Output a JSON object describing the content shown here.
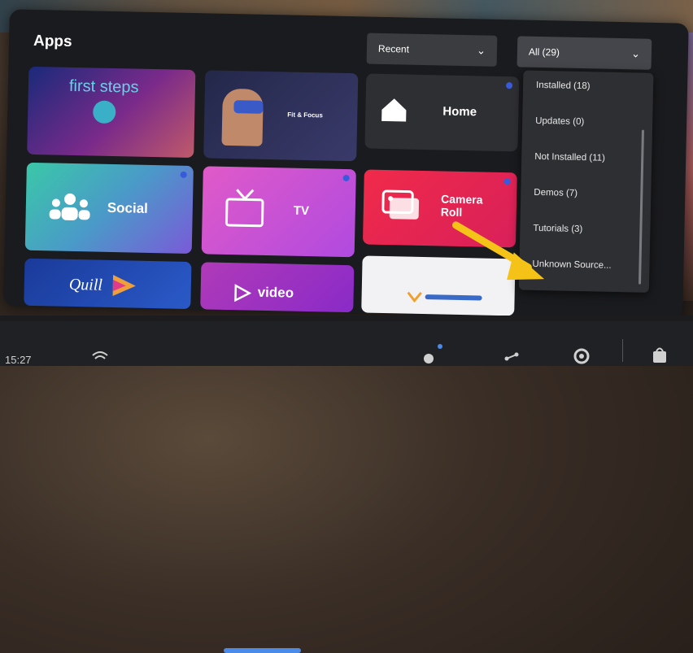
{
  "header": {
    "title": "Apps"
  },
  "filters": {
    "sort": {
      "label": "Recent"
    },
    "category": {
      "label": "All (29)",
      "options": [
        "Installed (18)",
        "Updates (0)",
        "Not Installed (11)",
        "Demos (7)",
        "Tutorials (3)",
        "Unknown Source..."
      ]
    }
  },
  "tiles": [
    {
      "label": "first steps"
    },
    {
      "label": "Fit & Focus"
    },
    {
      "label": "Home"
    },
    {
      "label": "Social"
    },
    {
      "label": "TV"
    },
    {
      "label": "Camera Roll"
    },
    {
      "label": "Quill"
    },
    {
      "label": "video"
    },
    {
      "label": ""
    }
  ],
  "taskbar": {
    "time": "15:27"
  }
}
